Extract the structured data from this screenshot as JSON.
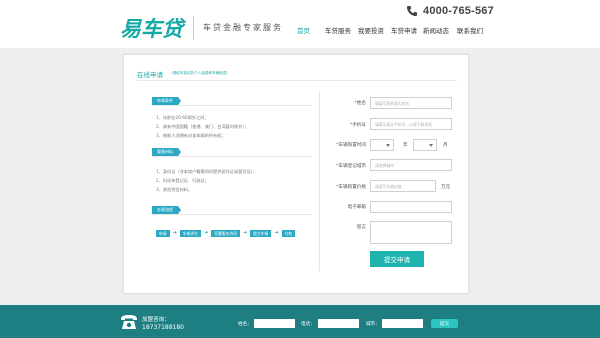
{
  "header": {
    "logo": "易车贷",
    "slogan": "车贷金融专家服务",
    "phone": "4000-765-567",
    "nav": [
      {
        "label": "首页",
        "active": true
      },
      {
        "label": "车贷服务",
        "active": false
      },
      {
        "label": "我要投资",
        "active": false
      },
      {
        "label": "车贷申请",
        "active": false
      },
      {
        "label": "新闻动态",
        "active": false
      },
      {
        "label": "联系我们",
        "active": false
      }
    ]
  },
  "form": {
    "title": "在线申请",
    "subtitle": "（请填写真实的个人信息和车辆信息）",
    "conditions": {
      "heading": "申请条件",
      "items": [
        "1、年龄在20-60周岁之间；",
        "2、具有中国国籍（香港、澳门、台湾暂时除外）；",
        "3、借款人须拥有对该车辆的所有权；"
      ]
    },
    "materials": {
      "heading": "要备材料",
      "items": [
        "1、身份证（非本地户籍需同时提供居住证或暂住证）；",
        "2、机动车登记证、行驶证；",
        "3、其他资信材料。"
      ]
    },
    "process": {
      "heading": "办理流程",
      "steps": [
        "申请",
        "车辆评估",
        "签署服务合同",
        "提交车辆",
        "付款"
      ]
    },
    "fields": {
      "name_label": "姓名",
      "name_placeholder": "请填写您的真实姓名",
      "mobile_label": "手机号",
      "mobile_placeholder": "请填写真实手机号，以便于联系您",
      "purchase_time_label": "车辆购置时间",
      "year_unit": "年",
      "month_unit": "月",
      "city_label": "车辆登记城市",
      "city_placeholder": "请选择城市",
      "price_label": "车辆购置价格",
      "price_placeholder": "请填写车辆价格",
      "price_unit": "万元",
      "email_label": "电子邮箱",
      "remark_label": "留言",
      "required_mark": "*"
    },
    "submit_label": "提交申请"
  },
  "footer": {
    "title": "加盟咨询：",
    "number": "18737188180",
    "name_label": "姓名：",
    "phone_label": "电话：",
    "city_label": "城市：",
    "submit_label": "提交"
  },
  "colors": {
    "brand": "#16a9a5",
    "tag": "#2aa8c4",
    "footer": "#1e7f83"
  }
}
